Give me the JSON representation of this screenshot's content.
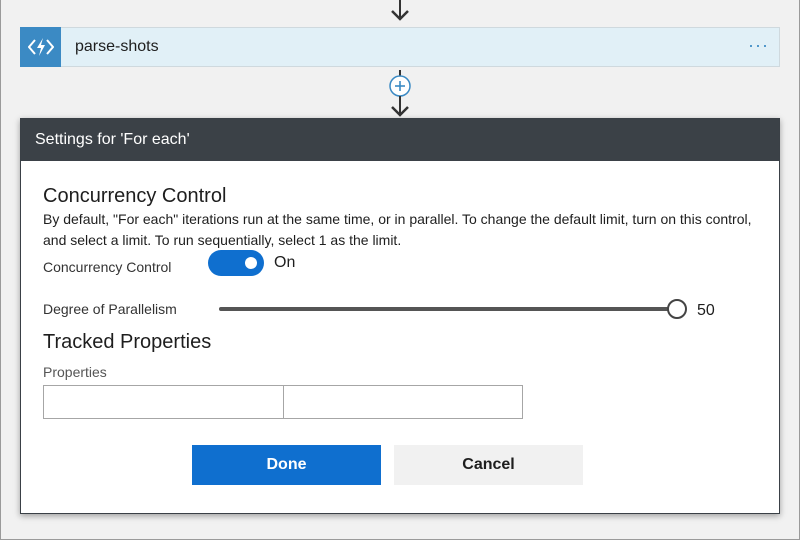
{
  "flow": {
    "action_title": "parse-shots",
    "action_menu_label": "···"
  },
  "dialog": {
    "header_title": "Settings for 'For each'",
    "concurrency": {
      "section_title": "Concurrency Control",
      "description": "By default, \"For each\" iterations run at the same time, or in parallel. To change the default limit, turn on this control, and select a limit. To run sequentially, select 1 as the limit.",
      "toggle_label": "Concurrency Control",
      "toggle_state": "On",
      "toggle_on": true
    },
    "parallelism": {
      "label": "Degree of Parallelism",
      "value": "50",
      "min": 1,
      "max": 50,
      "fraction": 1.0
    },
    "tracked": {
      "section_title": "Tracked Properties",
      "properties_label": "Properties",
      "key_value": "",
      "value_value": ""
    },
    "buttons": {
      "done": "Done",
      "cancel": "Cancel"
    }
  },
  "colors": {
    "accent": "#0f6fcf",
    "action_icon_bg": "#3b8ac4",
    "action_bg": "#e1f0f7",
    "header_bg": "#3b4147"
  },
  "icons": {
    "action": "lightning-bolt-icon",
    "add": "plus-circle-icon",
    "arrow": "arrow-down-icon"
  }
}
